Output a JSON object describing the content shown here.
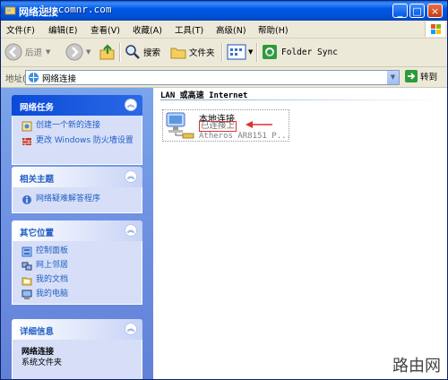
{
  "window": {
    "title": "网络连接",
    "url_overlay": "lu.comnr.com"
  },
  "title_buttons": {
    "minimize": "_",
    "maximize": "□",
    "close": "×"
  },
  "menu": [
    "文件(F)",
    "编辑(E)",
    "查看(V)",
    "收藏(A)",
    "工具(T)",
    "高级(N)",
    "帮助(H)"
  ],
  "toolbar": {
    "back": "后退",
    "search": "搜索",
    "folders": "文件夹",
    "folder_sync": "Folder Sync"
  },
  "address": {
    "label": "地址(D)",
    "value": "网络连接",
    "go": "转到"
  },
  "left_panel": {
    "network_tasks": {
      "title": "网络任务",
      "items": [
        "创建一个新的连接",
        "更改 Windows 防火墙设置"
      ]
    },
    "related": {
      "title": "相关主题",
      "items": [
        "网络疑难解答程序"
      ]
    },
    "other_places": {
      "title": "其它位置",
      "items": [
        "控制面板",
        "网上邻居",
        "我的文档",
        "我的电脑"
      ]
    },
    "details": {
      "title": "详细信息",
      "name": "网络连接",
      "type": "系统文件夹"
    }
  },
  "main": {
    "section_title": "LAN 或高速 Internet",
    "connection": {
      "name": "本地连接",
      "status": "已连接上",
      "device": "Atheros AR8151 P..."
    }
  },
  "watermark": "路由网",
  "colors": {
    "titlebar": "#0058e6",
    "panel": "#6c8ee0",
    "link": "#215dc6",
    "highlight": "#e03030"
  }
}
